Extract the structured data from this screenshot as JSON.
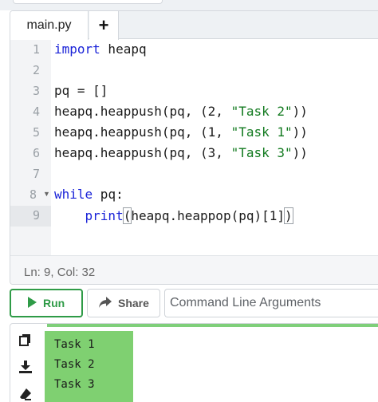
{
  "tabs": {
    "active_file": "main.py",
    "add_label": "+"
  },
  "editor": {
    "line_numbers": [
      "1",
      "2",
      "3",
      "4",
      "5",
      "6",
      "8",
      "9"
    ],
    "lines": {
      "l1": {
        "kw": "import",
        "rest": " heapq"
      },
      "l3": {
        "text": "pq = []"
      },
      "l4": {
        "pre": "heapq.heappush(pq, (2, ",
        "str": "\"Task 2\"",
        "post": "))"
      },
      "l5": {
        "pre": "heapq.heappush(pq, (1, ",
        "str": "\"Task 1\"",
        "post": "))"
      },
      "l6": {
        "pre": "heapq.heappush(pq, (3, ",
        "str": "\"Task 3\"",
        "post": "))"
      },
      "l8": {
        "kw": "while",
        "rest": " pq:"
      },
      "l9": {
        "indent": "    ",
        "fn": "print",
        "open": "(",
        "inner": "heapq.heappop(pq)[1]",
        "close": ")"
      }
    },
    "status": "Ln: 9,  Col: 32"
  },
  "controls": {
    "run_label": "Run",
    "share_label": "Share",
    "args_placeholder": "Command Line Arguments"
  },
  "output": {
    "lines": [
      "Task 1",
      "Task 2",
      "Task 3"
    ]
  },
  "colors": {
    "run_green": "#2f9b47",
    "output_highlight": "#7fd071",
    "keyword_blue": "#1a23d8",
    "string_green": "#127a1f"
  },
  "icons": [
    "play-icon",
    "share-icon",
    "copy-icon",
    "download-icon",
    "eraser-icon",
    "fold-arrow-icon"
  ]
}
